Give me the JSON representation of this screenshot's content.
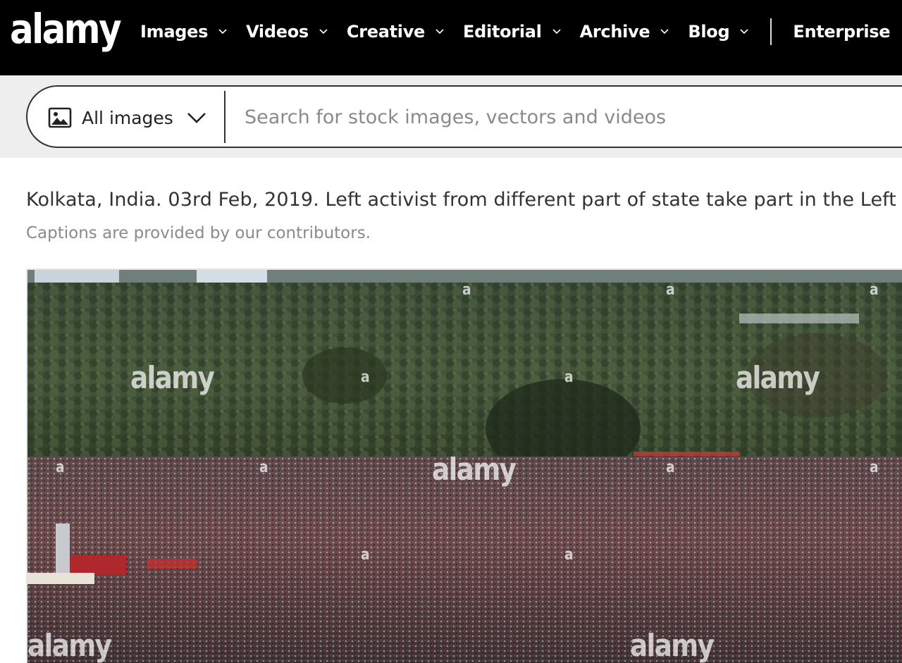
{
  "header": {
    "logo": "alamy",
    "nav": [
      {
        "label": "Images"
      },
      {
        "label": "Videos"
      },
      {
        "label": "Creative"
      },
      {
        "label": "Editorial"
      },
      {
        "label": "Archive"
      },
      {
        "label": "Blog"
      }
    ],
    "enterprise_label": "Enterprise"
  },
  "search": {
    "scope_label": "All images",
    "placeholder": "Search for stock images, vectors and videos",
    "value": ""
  },
  "caption": {
    "text": "Kolkata, India. 03rd Feb, 2019. Left activist from different part of state take part in the Left",
    "note": "Captions are provided by our contributors."
  },
  "photo": {
    "watermark_large": "alamy",
    "watermark_small": "a"
  },
  "colors": {
    "topbar": "#000000",
    "search_band": "#eeeeee",
    "caption_text": "#333333",
    "note_text": "#8a8a8a"
  }
}
